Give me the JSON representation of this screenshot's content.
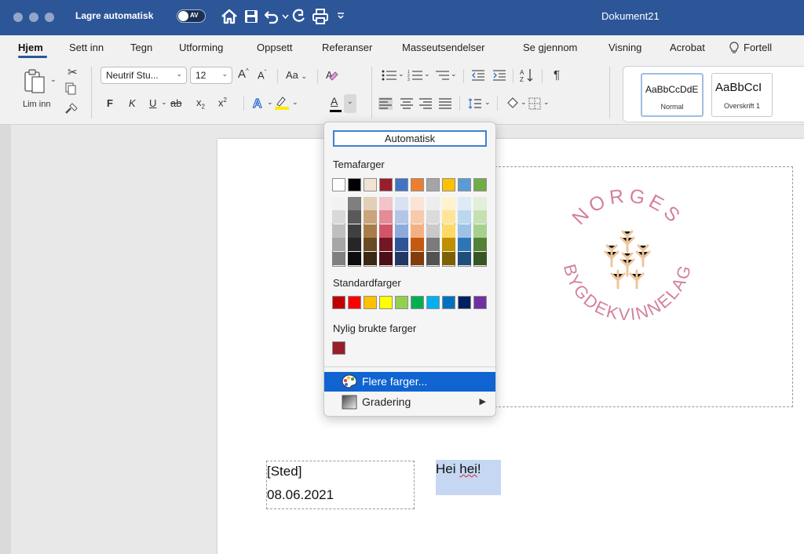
{
  "titlebar": {
    "autosave_label": "Lagre automatisk",
    "autosave_state": "AV",
    "document_title": "Dokument21",
    "icons": [
      "home-icon",
      "save-icon",
      "undo-icon",
      "redo-icon",
      "print-icon",
      "customize-toolbar-icon"
    ]
  },
  "tabs": [
    "Hjem",
    "Sett inn",
    "Tegn",
    "Utforming",
    "Oppsett",
    "Referanser",
    "Masseutsendelser",
    "Se gjennom",
    "Visning",
    "Acrobat",
    "Fortell"
  ],
  "active_tab": "Hjem",
  "ribbon": {
    "paste_label": "Lim inn",
    "font_name": "Neutrif Stu...",
    "font_size": "12",
    "grow_font": "A",
    "shrink_font": "A",
    "change_case": "Aa",
    "bold": "F",
    "italic": "K",
    "underline": "U",
    "strikethrough": "ab",
    "subscript": "x",
    "superscript": "x",
    "font_color_letter": "A",
    "pilcrow": "¶",
    "styles": [
      {
        "sample": "AaBbCcDdE",
        "name": "Normal"
      },
      {
        "sample": "AaBbCcI",
        "name": "Overskrift 1"
      }
    ]
  },
  "document": {
    "place": "[Sted]",
    "date": "08.06.2021",
    "greeting_plain": "Hei ",
    "greeting_misspelled": "hei",
    "greeting_end": "!",
    "logo_top_text": "NORGES",
    "logo_bottom_text": "BYGDEKVINNELAG",
    "logo_color": "#d4819a"
  },
  "color_menu": {
    "automatic": "Automatisk",
    "theme_heading": "Temafarger",
    "theme_colors": [
      "#ffffff",
      "#000000",
      "#f1e4d4",
      "#9a1d2c",
      "#4472c4",
      "#ed7d31",
      "#a5a5a5",
      "#ffc000",
      "#5b9bd5",
      "#70ad47"
    ],
    "theme_shades": [
      [
        "#f2f2f2",
        "#d9d9d9",
        "#bfbfbf",
        "#a6a6a6",
        "#808080"
      ],
      [
        "#7f7f7f",
        "#595959",
        "#404040",
        "#262626",
        "#0d0d0d"
      ],
      [
        "#e2cfb8",
        "#c8a57a",
        "#a87d4a",
        "#6b4b24",
        "#3b2913"
      ],
      [
        "#f2c3c9",
        "#e38c97",
        "#d15567",
        "#741623",
        "#4d0f17"
      ],
      [
        "#d9e2f3",
        "#b4c6e7",
        "#8eaadb",
        "#2f5496",
        "#1f3864"
      ],
      [
        "#fbe4d5",
        "#f7caac",
        "#f4b083",
        "#c45911",
        "#833c0b"
      ],
      [
        "#ededed",
        "#dbdbdb",
        "#c9c9c9",
        "#7b7b7b",
        "#525252"
      ],
      [
        "#fff2cc",
        "#ffe599",
        "#ffd966",
        "#bf8f00",
        "#7f6000"
      ],
      [
        "#deebf6",
        "#bdd7ee",
        "#9cc3e5",
        "#2e75b5",
        "#1e4e79"
      ],
      [
        "#e2efd9",
        "#c5e0b3",
        "#a8d08d",
        "#538135",
        "#375623"
      ]
    ],
    "standard_heading": "Standardfarger",
    "standard_colors": [
      "#c00000",
      "#ff0000",
      "#ffc000",
      "#ffff00",
      "#92d050",
      "#00b050",
      "#00b0f0",
      "#0070c0",
      "#002060",
      "#7030a0"
    ],
    "recent_heading": "Nylig brukte farger",
    "recent_colors": [
      "#9a1d2c"
    ],
    "more_colors": "Flere farger...",
    "gradient": "Gradering"
  }
}
